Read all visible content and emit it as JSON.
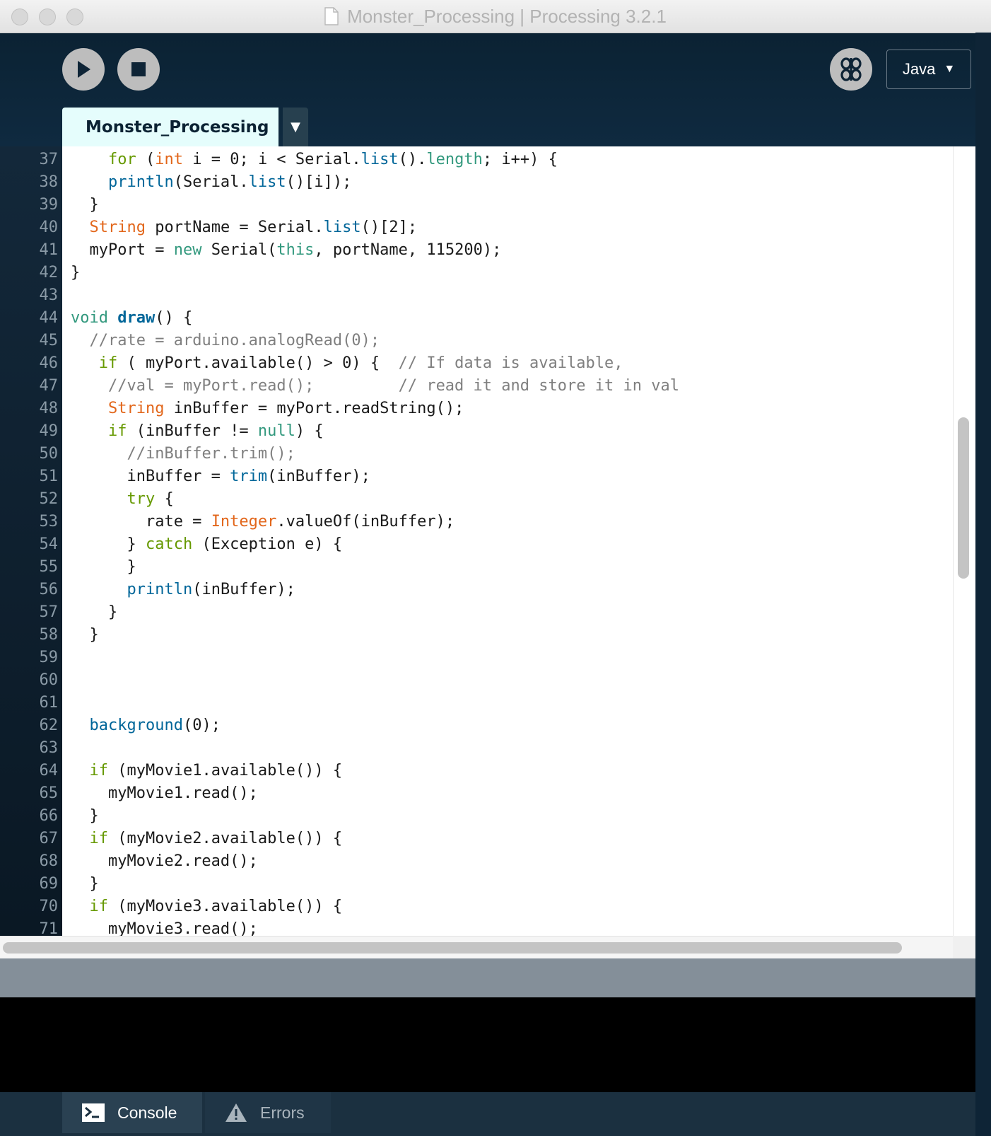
{
  "window": {
    "title": "Monster_Processing | Processing 3.2.1"
  },
  "toolbar": {
    "run_icon": "play-icon",
    "stop_icon": "stop-icon",
    "debug_icon": "debugger-butterfly-icon",
    "mode_label": "Java",
    "mode_arrow": "▼"
  },
  "tabs": {
    "active_label": "Monster_Processing",
    "menu_arrow": "▼"
  },
  "editor": {
    "lines": [
      {
        "n": "37",
        "tokens": [
          [
            "plain",
            "    "
          ],
          [
            "ctrl",
            "for"
          ],
          [
            "plain",
            " ("
          ],
          [
            "kw2",
            "int"
          ],
          [
            "plain",
            " i = 0; i < Serial."
          ],
          [
            "fn",
            "list"
          ],
          [
            "plain",
            "()."
          ],
          [
            "kw1",
            "length"
          ],
          [
            "plain",
            "; i++) {"
          ]
        ]
      },
      {
        "n": "38",
        "tokens": [
          [
            "plain",
            "    "
          ],
          [
            "fn",
            "println"
          ],
          [
            "plain",
            "(Serial."
          ],
          [
            "fn",
            "list"
          ],
          [
            "plain",
            "()[i]);"
          ]
        ]
      },
      {
        "n": "39",
        "tokens": [
          [
            "plain",
            "  }"
          ]
        ]
      },
      {
        "n": "40",
        "tokens": [
          [
            "plain",
            "  "
          ],
          [
            "kw2",
            "String"
          ],
          [
            "plain",
            " portName = Serial."
          ],
          [
            "fn",
            "list"
          ],
          [
            "plain",
            "()[2];"
          ]
        ]
      },
      {
        "n": "41",
        "tokens": [
          [
            "plain",
            "  myPort = "
          ],
          [
            "kw1",
            "new"
          ],
          [
            "plain",
            " Serial("
          ],
          [
            "kw1",
            "this"
          ],
          [
            "plain",
            ", portName, 115200);"
          ]
        ]
      },
      {
        "n": "42",
        "tokens": [
          [
            "plain",
            "}"
          ]
        ]
      },
      {
        "n": "43",
        "tokens": [
          [
            "plain",
            ""
          ]
        ]
      },
      {
        "n": "44",
        "tokens": [
          [
            "kw1",
            "void"
          ],
          [
            "plain",
            " "
          ],
          [
            "fnb",
            "draw"
          ],
          [
            "plain",
            "() {"
          ]
        ]
      },
      {
        "n": "45",
        "tokens": [
          [
            "plain",
            "  "
          ],
          [
            "cmt",
            "//rate = arduino.analogRead(0);"
          ]
        ]
      },
      {
        "n": "46",
        "tokens": [
          [
            "plain",
            "   "
          ],
          [
            "ctrl",
            "if"
          ],
          [
            "plain",
            " ( myPort.available() > 0) {  "
          ],
          [
            "cmt",
            "// If data is available,"
          ]
        ]
      },
      {
        "n": "47",
        "tokens": [
          [
            "plain",
            "    "
          ],
          [
            "cmt",
            "//val = myPort.read();         // read it and store it in val"
          ]
        ]
      },
      {
        "n": "48",
        "tokens": [
          [
            "plain",
            "    "
          ],
          [
            "kw2",
            "String"
          ],
          [
            "plain",
            " inBuffer = myPort.readString();"
          ]
        ]
      },
      {
        "n": "49",
        "tokens": [
          [
            "plain",
            "    "
          ],
          [
            "ctrl",
            "if"
          ],
          [
            "plain",
            " (inBuffer != "
          ],
          [
            "kw1",
            "null"
          ],
          [
            "plain",
            ") {"
          ]
        ]
      },
      {
        "n": "50",
        "tokens": [
          [
            "plain",
            "      "
          ],
          [
            "cmt",
            "//inBuffer.trim();"
          ]
        ]
      },
      {
        "n": "51",
        "tokens": [
          [
            "plain",
            "      inBuffer = "
          ],
          [
            "fn",
            "trim"
          ],
          [
            "plain",
            "(inBuffer);"
          ]
        ]
      },
      {
        "n": "52",
        "tokens": [
          [
            "plain",
            "      "
          ],
          [
            "ctrl",
            "try"
          ],
          [
            "plain",
            " {"
          ]
        ]
      },
      {
        "n": "53",
        "tokens": [
          [
            "plain",
            "        rate = "
          ],
          [
            "kw2",
            "Integer"
          ],
          [
            "plain",
            ".valueOf(inBuffer);"
          ]
        ]
      },
      {
        "n": "54",
        "tokens": [
          [
            "plain",
            "      } "
          ],
          [
            "ctrl",
            "catch"
          ],
          [
            "plain",
            " (Exception e) {"
          ]
        ]
      },
      {
        "n": "55",
        "tokens": [
          [
            "plain",
            "      }"
          ]
        ]
      },
      {
        "n": "56",
        "tokens": [
          [
            "plain",
            "      "
          ],
          [
            "fn",
            "println"
          ],
          [
            "plain",
            "(inBuffer);"
          ]
        ]
      },
      {
        "n": "57",
        "tokens": [
          [
            "plain",
            "    }"
          ]
        ]
      },
      {
        "n": "58",
        "tokens": [
          [
            "plain",
            "  }"
          ]
        ]
      },
      {
        "n": "59",
        "tokens": [
          [
            "plain",
            ""
          ]
        ]
      },
      {
        "n": "60",
        "tokens": [
          [
            "plain",
            ""
          ]
        ]
      },
      {
        "n": "61",
        "tokens": [
          [
            "plain",
            ""
          ]
        ]
      },
      {
        "n": "62",
        "tokens": [
          [
            "plain",
            "  "
          ],
          [
            "fn",
            "background"
          ],
          [
            "plain",
            "(0);"
          ]
        ]
      },
      {
        "n": "63",
        "tokens": [
          [
            "plain",
            ""
          ]
        ]
      },
      {
        "n": "64",
        "tokens": [
          [
            "plain",
            "  "
          ],
          [
            "ctrl",
            "if"
          ],
          [
            "plain",
            " (myMovie1.available()) {"
          ]
        ]
      },
      {
        "n": "65",
        "tokens": [
          [
            "plain",
            "    myMovie1.read();"
          ]
        ]
      },
      {
        "n": "66",
        "tokens": [
          [
            "plain",
            "  }"
          ]
        ]
      },
      {
        "n": "67",
        "tokens": [
          [
            "plain",
            "  "
          ],
          [
            "ctrl",
            "if"
          ],
          [
            "plain",
            " (myMovie2.available()) {"
          ]
        ]
      },
      {
        "n": "68",
        "tokens": [
          [
            "plain",
            "    myMovie2.read();"
          ]
        ]
      },
      {
        "n": "69",
        "tokens": [
          [
            "plain",
            "  }"
          ]
        ]
      },
      {
        "n": "70",
        "tokens": [
          [
            "plain",
            "  "
          ],
          [
            "ctrl",
            "if"
          ],
          [
            "plain",
            " (myMovie3.available()) {"
          ]
        ]
      },
      {
        "n": "71",
        "tokens": [
          [
            "plain",
            "    myMovie3.read();"
          ]
        ]
      }
    ]
  },
  "footer": {
    "console_label": "Console",
    "errors_label": "Errors",
    "console_icon": "terminal-icon",
    "errors_icon": "warning-icon"
  },
  "colors": {
    "window_bg": "#0e2436",
    "tab_active": "#e5fdfc",
    "keyword_teal": "#33997e",
    "keyword_orange": "#e2661a",
    "function_blue": "#006699",
    "control_green": "#669900",
    "comment_gray": "#7f7f7f"
  }
}
